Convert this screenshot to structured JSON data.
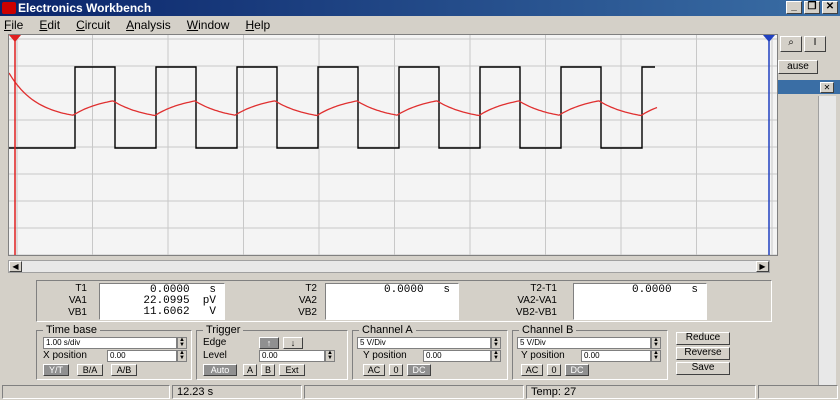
{
  "window": {
    "title": "Electronics Workbench"
  },
  "menu": [
    "File",
    "Edit",
    "Circuit",
    "Analysis",
    "Window",
    "Help"
  ],
  "right_panel": {
    "pause_label": "ause"
  },
  "readouts": {
    "t1_label": "T1",
    "t1_value": "0.0000   s",
    "va1_label": "VA1",
    "va1_value": "22.0995  pV",
    "vb1_label": "VB1",
    "vb1_value": "11.6062   V",
    "t2_label": "T2",
    "t2_value": "0.0000   s",
    "va2_label": "VA2",
    "vb2_label": "VB2",
    "dt_label": "T2-T1",
    "dt_value": "0.0000   s",
    "dva_label": "VA2-VA1",
    "dvb_label": "VB2-VB1"
  },
  "timebase": {
    "title": "Time base",
    "scale": "1.00 s/div",
    "xpos_label": "X position",
    "xpos": "0.00",
    "btn_yt": "Y/T",
    "btn_ba": "B/A",
    "btn_ab": "A/B"
  },
  "trigger": {
    "title": "Trigger",
    "edge_label": "Edge",
    "level_label": "Level",
    "level": "0.00",
    "btn_auto": "Auto",
    "btn_a": "A",
    "btn_b": "B",
    "btn_ext": "Ext"
  },
  "channel_a": {
    "title": "Channel A",
    "scale": "5 V/Div",
    "ypos_label": "Y position",
    "ypos": "0.00",
    "btn_ac": "AC",
    "btn_0": "0",
    "btn_dc": "DC"
  },
  "channel_b": {
    "title": "Channel B",
    "scale": "5 V/Div",
    "ypos_label": "Y position",
    "ypos": "0.00",
    "btn_ac": "AC",
    "btn_0": "0",
    "btn_dc": "DC"
  },
  "actions": {
    "reduce": "Reduce",
    "reverse": "Reverse",
    "save": "Save"
  },
  "status": {
    "time": "12.23 s",
    "temp": "Temp:  27"
  },
  "colors": {
    "square_wave": "#000000",
    "rc_wave": "#e03030",
    "cursor1": "#e02020",
    "cursor2": "#2040c0"
  }
}
